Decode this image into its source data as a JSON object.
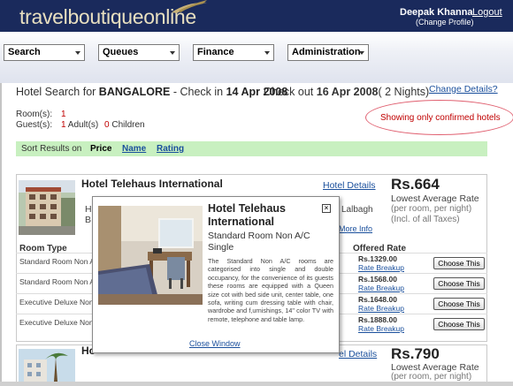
{
  "header": {
    "logo_part1": "travelboutique",
    "logo_part2": "online",
    "user_name": "Deepak Khanna",
    "logout_label": "Logout",
    "change_profile_label": "(Change Profile)"
  },
  "menu": [
    {
      "label": "Search"
    },
    {
      "label": "Queues"
    },
    {
      "label": "Finance"
    },
    {
      "label": "Administration"
    }
  ],
  "search_summary": {
    "prefix": "Hotel Search for ",
    "city": "BANGALORE",
    "checkin_prefix": " - Check in ",
    "checkin_date": "14 Apr 2008",
    "checkout_prefix": "Check out ",
    "checkout_date": "16 Apr 2008",
    "nights": "( 2 Nights)",
    "change_details_label": "Change Details?"
  },
  "occupancy": {
    "rooms_label": "Room(s):",
    "rooms_value": "1",
    "guests_label": "Guest(s):",
    "adults_value": "1",
    "adults_suffix": " Adult(s)",
    "children_value": "0",
    "children_suffix": " Children"
  },
  "confirmed_note": "Showing only confirmed hotels",
  "sort": {
    "label": "Sort Results on",
    "price": "Price",
    "name": "Name",
    "rating": "Rating"
  },
  "hotels": [
    {
      "name": "Hotel Telehaus International",
      "details_label": "Hotel Details",
      "price": "Rs.664",
      "lowest_label": "Lowest Average Rate",
      "per_room": "(per room, per night)",
      "taxes": "(Incl. of all Taxes)",
      "address_fragment": "Lalbagh",
      "more_info": "More Info",
      "address_initial_1": "H",
      "address_initial_2": "B"
    },
    {
      "name": "Ho",
      "details_label": "el Details",
      "price": "Rs.790",
      "lowest_label": "Lowest Average Rate",
      "per_room": "(per room, per night)"
    }
  ],
  "room_table": {
    "col_room_type": "Room Type",
    "col_offered_rate": "Offered Rate",
    "rows": [
      {
        "name": "Standard Room Non A",
        "price": "Rs.1329.00",
        "breakup": "Rate Breakup",
        "button": "Choose This"
      },
      {
        "name": "Standard Room Non A",
        "price": "Rs.1568.00",
        "breakup": "Rate Breakup",
        "button": "Choose This"
      },
      {
        "name": "Executive Deluxe Non .",
        "price": "Rs.1648.00",
        "breakup": "Rate Breakup",
        "button": "Choose This"
      },
      {
        "name": "Executive Deluxe Non .",
        "price": "Rs.1888.00",
        "breakup": "Rate Breakup",
        "button": "Choose This"
      }
    ]
  },
  "popup": {
    "title": "Hotel Telehaus International",
    "room": "Standard Room Non A/C Single",
    "description": "The Standard Non A/C rooms are categorised into single and double occupancy, for the convenience of its guests these rooms are equipped with a Queen size cot with bed side unit, center table, one sofa, writing cum dressing table with chair, wardrobe and f,urnishings, 14\" color TV with remote, telephone and table lamp.",
    "close_glyph": "×",
    "close_label": "Close Window"
  },
  "colors": {
    "header_bg": "#1a2a5c",
    "sort_bar_bg": "#c8f0c0",
    "link": "#1a4f9c",
    "alert_red": "#c00000"
  }
}
